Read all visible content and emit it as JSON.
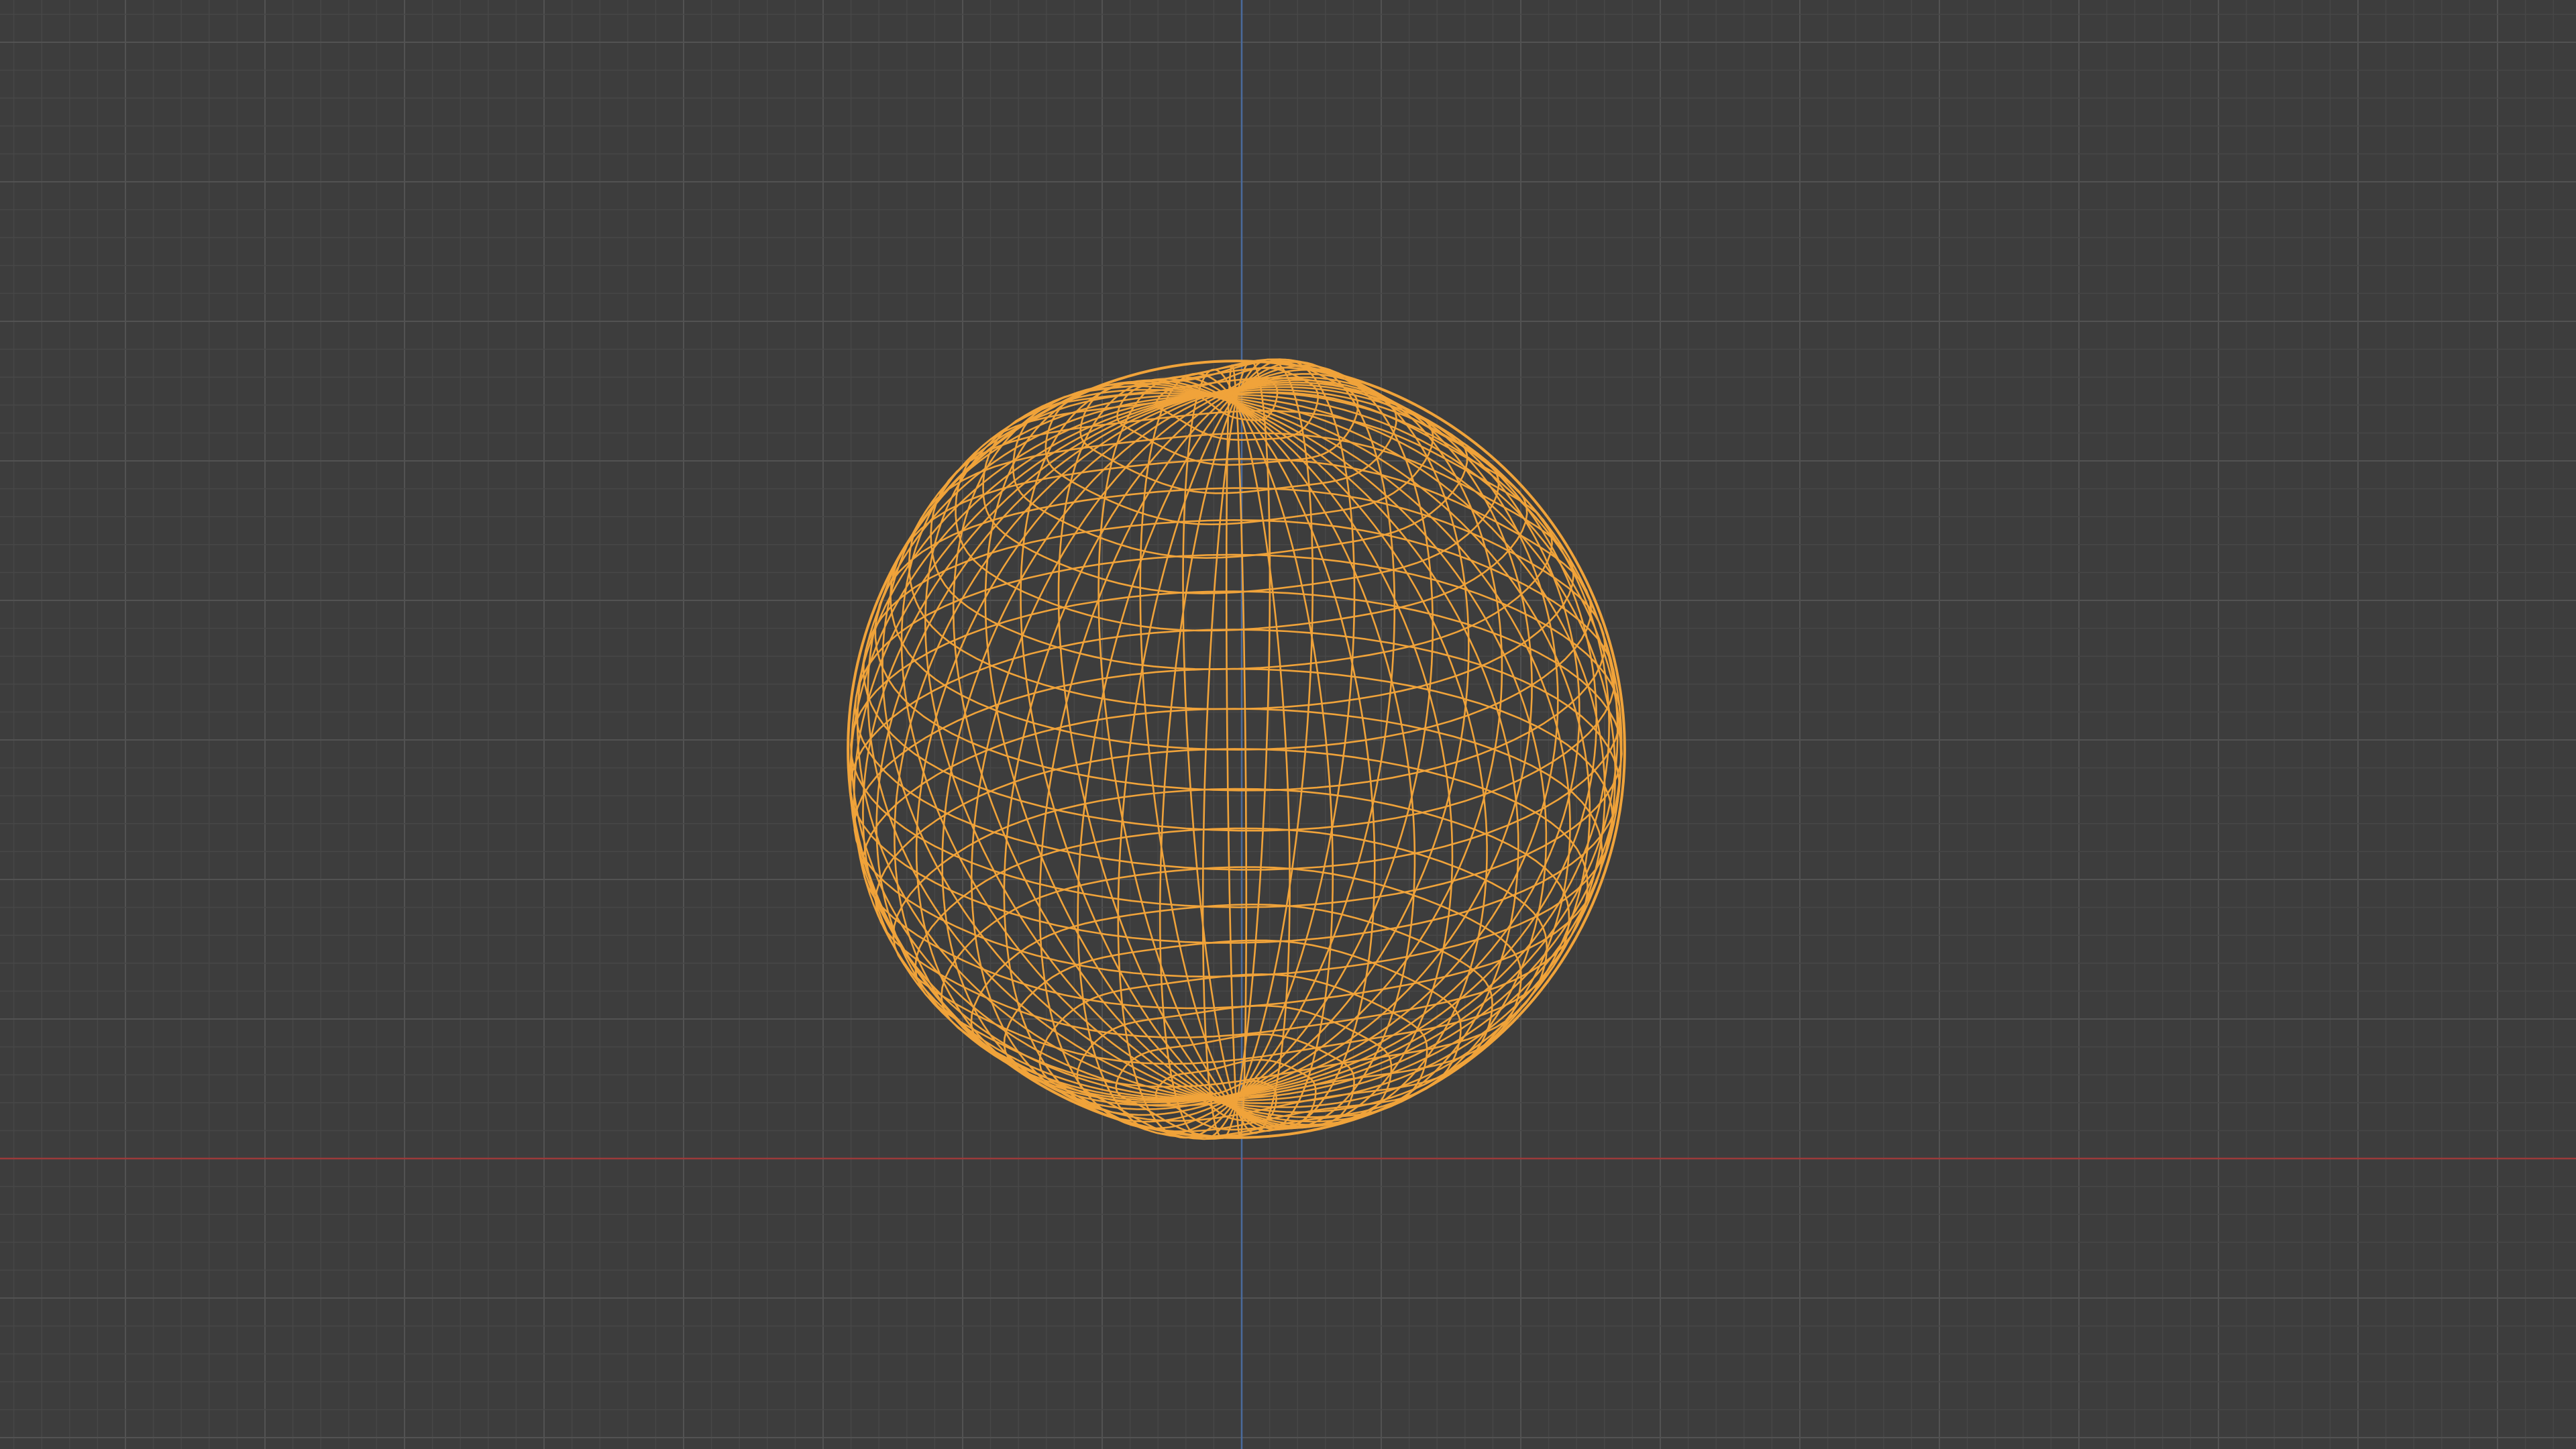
{
  "viewport": {
    "view_mode": "wireframe",
    "background_color": "#3d3d3d",
    "grid_minor_color": "#474747",
    "grid_major_color": "#525252",
    "x_axis_color": "#9b3a3a",
    "z_axis_color": "#4a6a9c",
    "wireframe_color": "#f0a33a",
    "object": {
      "icon": "uv-sphere-icon",
      "type": "mesh",
      "selected": true
    }
  }
}
